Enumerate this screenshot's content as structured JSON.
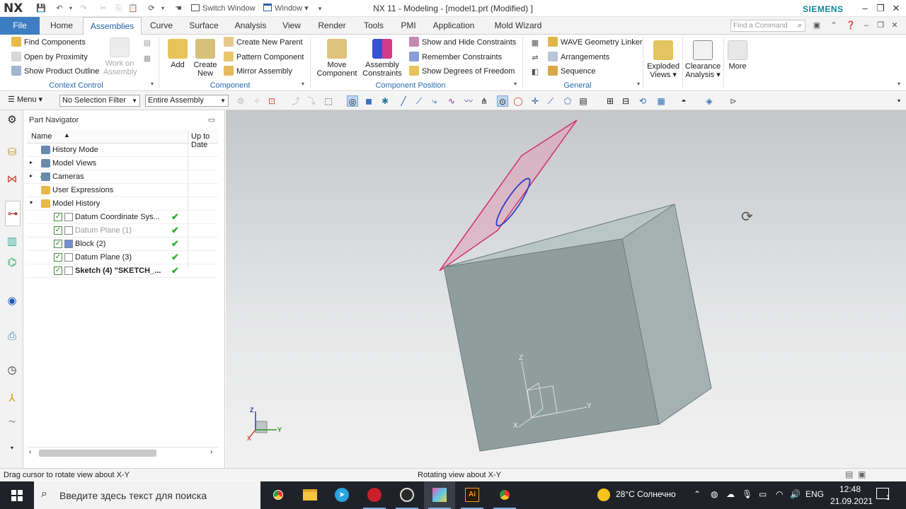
{
  "app": {
    "logo": "NX",
    "title": "NX 11 - Modeling - [model1.prt (Modified) ]",
    "brand": "SIEMENS",
    "quick_switch_window": "Switch Window",
    "quick_window": "Window"
  },
  "tabs": [
    "File",
    "Home",
    "Assemblies",
    "Curve",
    "Surface",
    "Analysis",
    "View",
    "Render",
    "Tools",
    "PMI",
    "Application",
    "Mold Wizard"
  ],
  "active_tab": "Assemblies",
  "command_finder_placeholder": "Find a Command",
  "ribbon": {
    "context_control": {
      "label": "Context Control",
      "find_components": "Find Components",
      "open_by_proximity": "Open by Proximity",
      "show_product_outline": "Show Product Outline",
      "work_on_assembly": "Work on Assembly"
    },
    "component": {
      "label": "Component",
      "add": "Add",
      "create_new": "Create New",
      "create_new_parent": "Create New Parent",
      "pattern_component": "Pattern Component",
      "mirror_assembly": "Mirror Assembly"
    },
    "component_position": {
      "label": "Component Position",
      "move_component": "Move Component",
      "assembly_constraints": "Assembly Constraints",
      "show_hide_constraints": "Show and Hide Constraints",
      "remember_constraints": "Remember Constraints",
      "show_dof": "Show Degrees of Freedom"
    },
    "general": {
      "label": "General",
      "wave_linker": "WAVE Geometry Linker",
      "arrangements": "Arrangements",
      "sequence": "Sequence"
    },
    "exploded_views": "Exploded Views",
    "clearance_analysis": "Clearance Analysis",
    "more": "More"
  },
  "toolbar": {
    "menu": "Menu",
    "selection_filter": "No Selection Filter",
    "scope": "Entire Assembly"
  },
  "navigator": {
    "title": "Part Navigator",
    "col_name": "Name",
    "col_uptodate": "Up to Date",
    "rows": [
      {
        "label": "History Mode",
        "indent": 1,
        "checked": false,
        "uptodate": false,
        "bold": false,
        "dim": false
      },
      {
        "label": "Model Views",
        "indent": 1,
        "checked": false,
        "uptodate": false,
        "bold": false,
        "dim": false
      },
      {
        "label": "Cameras",
        "indent": 1,
        "checked": false,
        "uptodate": false,
        "bold": false,
        "dim": false
      },
      {
        "label": "User Expressions",
        "indent": 1,
        "checked": false,
        "uptodate": false,
        "bold": false,
        "dim": false
      },
      {
        "label": "Model History",
        "indent": 1,
        "checked": false,
        "uptodate": false,
        "bold": false,
        "dim": false
      },
      {
        "label": "Datum Coordinate Sys...",
        "indent": 2,
        "checked": true,
        "uptodate": true,
        "bold": false,
        "dim": false
      },
      {
        "label": "Datum Plane (1)",
        "indent": 2,
        "checked": true,
        "uptodate": true,
        "bold": false,
        "dim": true
      },
      {
        "label": "Block (2)",
        "indent": 2,
        "checked": true,
        "uptodate": true,
        "bold": false,
        "dim": false
      },
      {
        "label": "Datum Plane (3)",
        "indent": 2,
        "checked": true,
        "uptodate": true,
        "bold": false,
        "dim": false
      },
      {
        "label": "Sketch (4) \"SKETCH_...",
        "indent": 2,
        "checked": true,
        "uptodate": true,
        "bold": true,
        "dim": false
      }
    ]
  },
  "viewport": {
    "triad_labels": {
      "x": "X",
      "y": "Y",
      "z": "Z"
    }
  },
  "status": {
    "left": "Drag cursor to rotate view about X-Y",
    "center": "Rotating view about X-Y"
  },
  "taskbar": {
    "search_placeholder": "Введите здесь текст для поиска",
    "weather": "28°C  Солнечно",
    "lang": "ENG",
    "time": "12:48",
    "date": "21.09.2021",
    "notifications": "1"
  },
  "colors": {
    "accent": "#3d7ec2",
    "brand": "#0b8a9a",
    "ribbon_group_label": "#2a6cb0",
    "block_face_front": "#8f9e9d",
    "block_face_side": "#a3b2b1",
    "block_face_top": "#b8c6c5",
    "datum_plane": "#e0a0b8",
    "datum_edge": "#d0306a",
    "sketch_circle": "#2a3fd0",
    "uptodate_check": "#2db02d"
  }
}
